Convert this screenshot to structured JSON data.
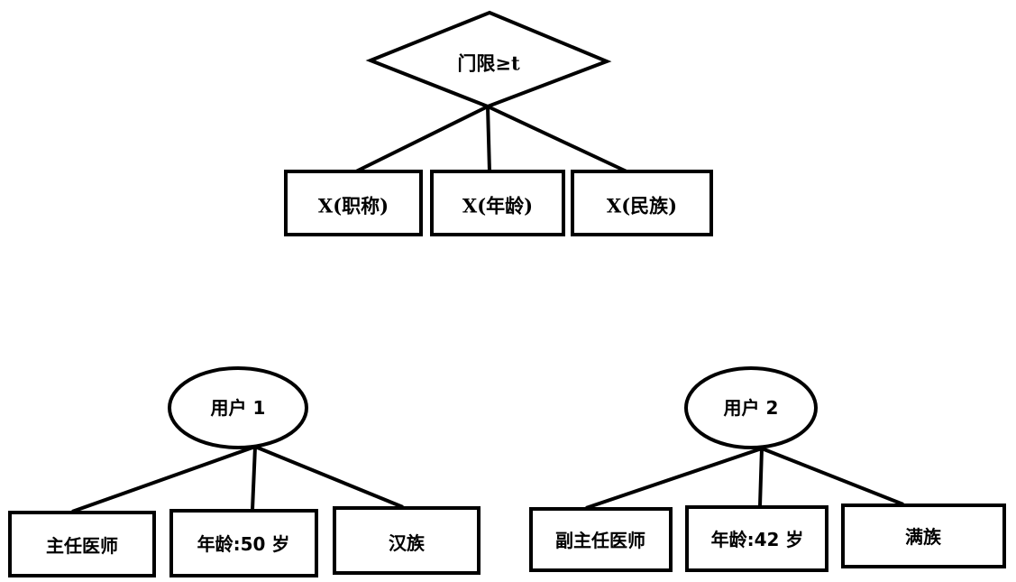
{
  "diagram": {
    "policy": {
      "root": "门限≥t",
      "attributes": [
        "X(职称)",
        "X(年龄)",
        "X(民族)"
      ]
    },
    "users": [
      {
        "name": "用户 1",
        "attributes": [
          "主任医师",
          "年龄:50 岁",
          "汉族"
        ]
      },
      {
        "name": "用户 2",
        "attributes": [
          "副主任医师",
          "年龄:42 岁",
          "满族"
        ]
      }
    ],
    "colors": {
      "stroke": "#000000",
      "fill": "#ffffff"
    }
  }
}
